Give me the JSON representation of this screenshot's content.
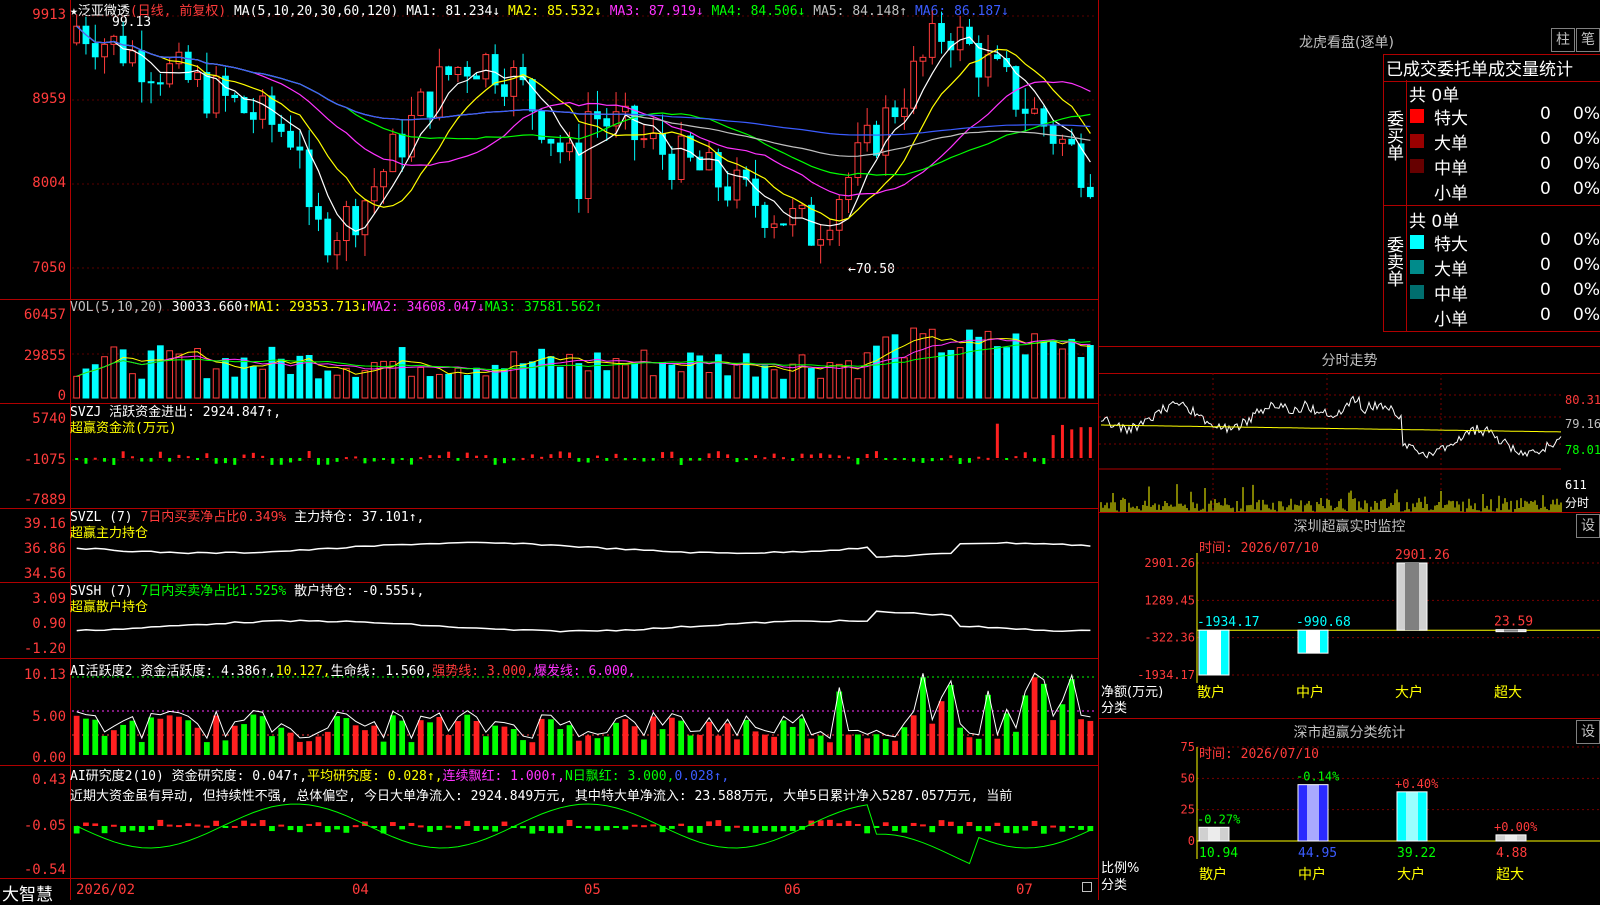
{
  "main": {
    "star": "★",
    "stock_name": "泛亚微透",
    "period_label": "(日线, 前复权)",
    "ma_label": "MA(5,10,20,30,60,120)",
    "ma_values": [
      {
        "label": "MA1: 81.234↓",
        "color": "#ffffff"
      },
      {
        "label": "MA2: 85.532↓",
        "color": "#ffff00"
      },
      {
        "label": "MA3: 87.919↓",
        "color": "#ff33ff"
      },
      {
        "label": "MA4: 84.506↓",
        "color": "#00ff00"
      },
      {
        "label": "MA5: 84.148↑",
        "color": "#c0c0c0"
      },
      {
        "label": "MA6: 86.187↓",
        "color": "#3b5cff"
      }
    ],
    "y_ticks": [
      "9913",
      "8959",
      "8004",
      "7050"
    ],
    "high_label": "99.13",
    "low_label": "←70.50"
  },
  "vol": {
    "label": "VOL(5,10,20)",
    "value": "30033.660↑",
    "ma1": "MA1: 29353.713↓",
    "ma2": "MA2: 34608.047↓",
    "ma3": "MA3: 37581.562↑",
    "y_ticks": [
      "60457",
      "29855",
      "0"
    ]
  },
  "svzj": {
    "label": "SVZJ",
    "text1": "活跃资金进出: 2924.847↑,",
    "text2": "超赢资金流(万元)",
    "y_ticks": [
      "5740",
      "-1075",
      "-7889"
    ]
  },
  "svzl": {
    "label": "SVZL (7)",
    "text1": "7日内买卖净占比0.349%",
    "text2": "主力持仓: 37.101↑,",
    "text3": "超赢主力持仓",
    "y_ticks": [
      "39.16",
      "36.86",
      "34.56"
    ]
  },
  "svsh": {
    "label": "SVSH (7)",
    "text1": "7日内买卖净占比1.525%",
    "text2": "散户持仓: -0.555↓,",
    "text3": "超赢散户持仓",
    "y_ticks": [
      "3.09",
      "0.90",
      "-1.20"
    ]
  },
  "ai1": {
    "label": "AI活跃度2",
    "t1": "资金活跃度: 4.386↑,",
    "t2": "10.127,",
    "t3": "生命线: 1.560,",
    "t4": "强势线: 3.000,",
    "t5": "爆发线: 6.000,",
    "y_ticks": [
      "10.13",
      "5.00",
      "0.00"
    ]
  },
  "ai2": {
    "label": "AI研究度2(10)",
    "t1": "资金研究度: 0.047↑,",
    "t2": "平均研究度: 0.028↑,",
    "t3": "连续飘红: 1.000↑,",
    "t4": "N日飘红: 3.000,",
    "t5": "0.028↑,",
    "comment": "近期大资金虽有异动, 但持续性不强, 总体偏空, 今日大单净流入: 2924.849万元, 其中特大单净流入: 23.588万元, 大单5日累计净入5287.057万元, 当前",
    "y_ticks": [
      "0.43",
      "-0.05",
      "-0.54"
    ]
  },
  "bottom": {
    "brand": "大智慧",
    "dates": [
      "2026/02",
      "04",
      "05",
      "06",
      "07"
    ]
  },
  "right": {
    "lhb_title": "龙虎看盘(逐单)",
    "btn_zhu": "柱",
    "btn_bi": "笔",
    "tabs": [
      "已成交",
      "委托单",
      "成交量统计"
    ],
    "buy_side": "委买单",
    "sell_side": "委卖单",
    "buy_total": "共 0单",
    "sell_total": "共 0单",
    "buy_rows": [
      {
        "label": "特大",
        "count": "0",
        "pct": "0%",
        "color": "#ff0000"
      },
      {
        "label": "大单",
        "count": "0",
        "pct": "0%",
        "color": "#990000"
      },
      {
        "label": "中单",
        "count": "0",
        "pct": "0%",
        "color": "#660000"
      },
      {
        "label": "小单",
        "count": "0",
        "pct": "0%",
        "color": ""
      }
    ],
    "sell_rows": [
      {
        "label": "特大",
        "count": "0",
        "pct": "0%",
        "color": "#00ffff"
      },
      {
        "label": "大单",
        "count": "0",
        "pct": "0%",
        "color": "#008b8b"
      },
      {
        "label": "中单",
        "count": "0",
        "pct": "0%",
        "color": "#006e6e"
      },
      {
        "label": "小单",
        "count": "0",
        "pct": "0%",
        "color": ""
      }
    ],
    "fs_title": "分时走势",
    "fs_ticks": [
      "80.31",
      "79.16",
      "78.01",
      "611",
      "分时"
    ],
    "monitor_title": "深圳超赢实时监控",
    "monitor_btn": "设",
    "monitor_time": "时间: 2026/07/10",
    "monitor_yticks": [
      "2901.26",
      "1289.45",
      "-322.36",
      "-1934.17"
    ],
    "monitor_ylabel": "净额(万元)",
    "monitor_xlabel": "分类",
    "monitor_cats": [
      "散户",
      "中户",
      "大户",
      "超大"
    ],
    "monitor_values": [
      "-1934.17",
      "-990.68",
      "2901.26",
      "23.59"
    ],
    "class_title": "深市超赢分类统计",
    "class_btn": "设",
    "class_time": "时间: 2026/07/10",
    "class_yticks": [
      "75",
      "50",
      "25",
      "0"
    ],
    "class_ylabel": "比例%",
    "class_xlabel": "分类",
    "class_cats": [
      "散户",
      "中户",
      "大户",
      "超大"
    ],
    "class_changes": [
      "-0.27%",
      "-0.14%",
      "+0.40%",
      "+0.00%"
    ],
    "class_values": [
      "10.94",
      "44.95",
      "39.22",
      "4.88"
    ]
  }
}
